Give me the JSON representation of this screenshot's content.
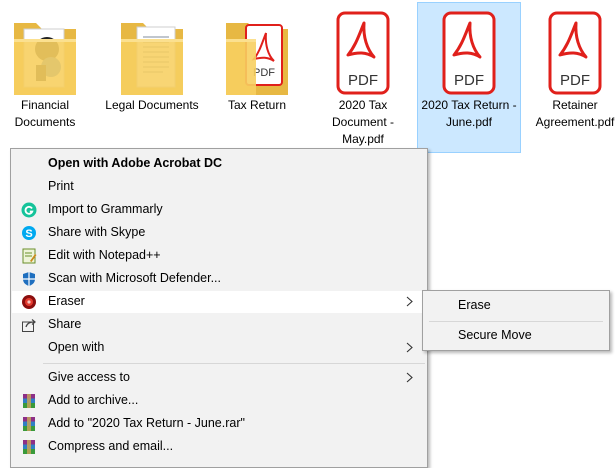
{
  "files": [
    {
      "label": "Financial Documents",
      "icon": "folder-icon",
      "selected": false
    },
    {
      "label": "Legal Documents",
      "icon": "folder-icon",
      "selected": false
    },
    {
      "label": "Tax Return",
      "icon": "folder-pdf-icon",
      "selected": false
    },
    {
      "label": "2020 Tax Document - May.pdf",
      "icon": "pdf-icon",
      "selected": false
    },
    {
      "label": "2020 Tax Return - June.pdf",
      "icon": "pdf-icon",
      "selected": true
    },
    {
      "label": "Retainer Agreement.pdf",
      "icon": "pdf-icon",
      "selected": false
    }
  ],
  "pdf_badge": "PDF",
  "context_menu": {
    "items": [
      {
        "label": "Open with Adobe Acrobat DC",
        "bold": true
      },
      {
        "label": "Print"
      },
      {
        "label": "Import to Grammarly",
        "icon": "grammarly-icon"
      },
      {
        "label": "Share with Skype",
        "icon": "skype-icon"
      },
      {
        "label": "Edit with Notepad++",
        "icon": "notepadpp-icon"
      },
      {
        "label": "Scan with Microsoft Defender...",
        "icon": "defender-icon"
      },
      {
        "label": "Eraser",
        "icon": "eraser-icon",
        "submenu": true,
        "hover": true
      },
      {
        "label": "Share",
        "icon": "share-icon"
      },
      {
        "label": "Open with",
        "submenu": true
      },
      {
        "label": "Give access to",
        "submenu": true
      },
      {
        "label": "Add to archive...",
        "icon": "winrar-icon"
      },
      {
        "label": "Add to \"2020 Tax Return - June.rar\"",
        "icon": "winrar-icon"
      },
      {
        "label": "Compress and email...",
        "icon": "winrar-icon"
      }
    ]
  },
  "eraser_submenu": {
    "items": [
      {
        "label": "Erase"
      },
      {
        "label": "Secure Move"
      }
    ]
  },
  "colors": {
    "selection_bg": "#cce8ff",
    "selection_border": "#99d1ff",
    "menu_bg": "#f2f2f2",
    "pdf_red": "#e0201b",
    "folder_yellow": "#f7cf61"
  }
}
